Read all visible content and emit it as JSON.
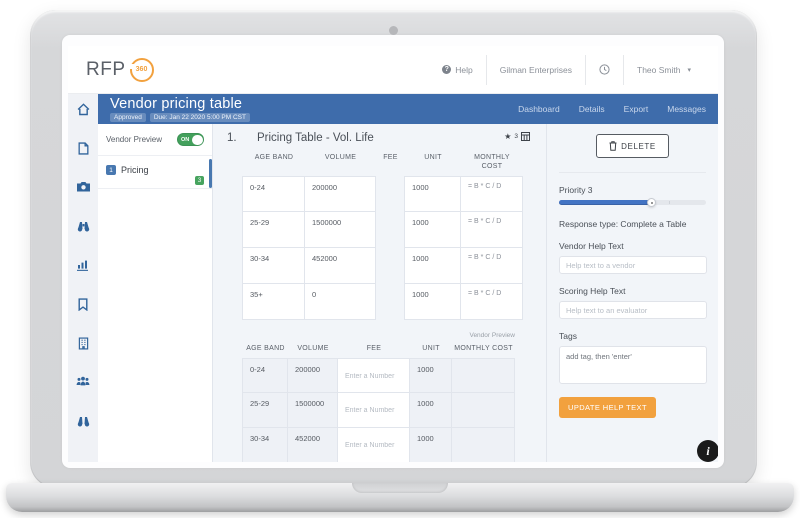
{
  "colors": {
    "header_blue": "#3e6cab",
    "toggle_green": "#43a05c",
    "badge_blue": "#4878b0",
    "badge_green": "#47a45f",
    "accent_orange": "#f2a13e",
    "priority_blue": "#4374c4",
    "info_black": "#1b1b1b"
  },
  "topbar": {
    "logo_text": "RFP",
    "logo_badge": "360",
    "help_label": "Help",
    "company": "Gilman Enterprises",
    "user": "Theo Smith",
    "user_caret": "▾"
  },
  "header": {
    "title": "Vendor pricing table",
    "status_badge": "Approved",
    "due_badge": "Due: Jan 22 2020 5:00 PM CST",
    "nav": [
      {
        "label": "Dashboard"
      },
      {
        "label": "Details"
      },
      {
        "label": "Export"
      },
      {
        "label": "Messages"
      }
    ]
  },
  "sidebar": {
    "icons": [
      "home-icon",
      "document-icon",
      "camera-icon",
      "binoculars-icon",
      "chart-icon",
      "bookmark-icon",
      "building-icon",
      "team-icon",
      "search-icon"
    ]
  },
  "nav_panel": {
    "vendor_preview_label": "Vendor Preview",
    "toggle_state": "ON",
    "item": {
      "index": "1",
      "label": "Pricing",
      "count": "3"
    }
  },
  "question": {
    "number": "1.",
    "title": "Pricing Table - Vol. Life",
    "star_icon": "★",
    "response_count": "3",
    "table": {
      "headers": [
        "AGE BAND",
        "VOLUME",
        "FEE",
        "UNIT",
        "MONTHLY COST"
      ],
      "rows": [
        [
          "0-24",
          "200000",
          "",
          "1000",
          "= B * C / D"
        ],
        [
          "25-29",
          "1500000",
          "",
          "1000",
          "= B * C / D"
        ],
        [
          "30-34",
          "452000",
          "",
          "1000",
          "= B * C / D"
        ],
        [
          "35+",
          "0",
          "",
          "1000",
          "= B * C / D"
        ]
      ]
    },
    "vendor_preview": {
      "label": "Vendor Preview",
      "headers": [
        "AGE BAND",
        "VOLUME",
        "FEE",
        "UNIT",
        "MONTHLY COST"
      ],
      "fee_placeholder": "Enter a Number",
      "rows": [
        [
          "0-24",
          "200000",
          "1000"
        ],
        [
          "25-29",
          "1500000",
          "1000"
        ],
        [
          "30-34",
          "452000",
          "1000"
        ]
      ]
    }
  },
  "details_panel": {
    "delete_label": "DELETE",
    "priority_label": "Priority 3",
    "priority_percent": 62,
    "response_type": "Response type: Complete a Table",
    "vendor_help_label": "Vendor Help Text",
    "vendor_help_placeholder": "Help text to a vendor",
    "scoring_help_label": "Scoring Help Text",
    "scoring_help_placeholder": "Help text to an evaluator",
    "tags_label": "Tags",
    "tags_placeholder": "add tag, then 'enter'",
    "update_button": "UPDATE HELP TEXT"
  },
  "info_button": "i"
}
